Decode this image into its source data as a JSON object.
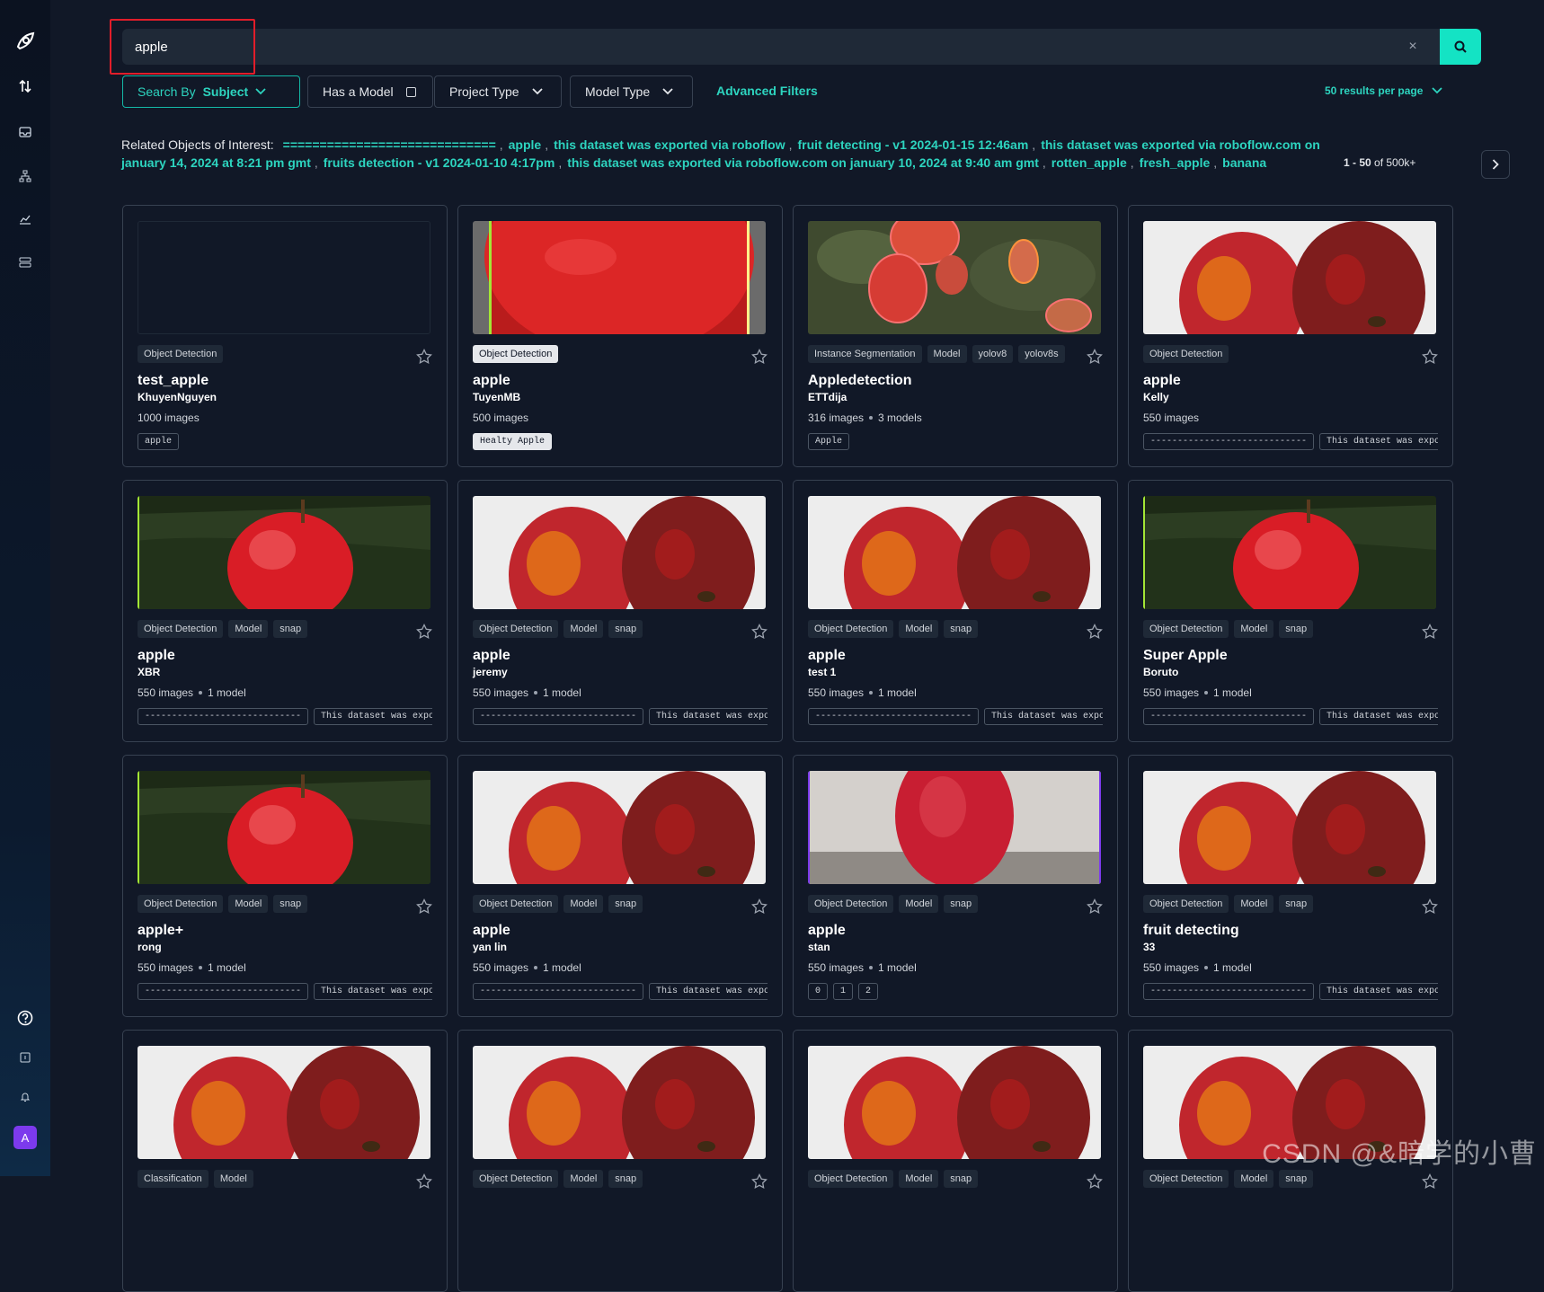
{
  "sidebar": {
    "avatar_letter": "A",
    "icons": [
      "roboflow-logo-icon",
      "sort-arrows-icon",
      "inbox-icon",
      "workflow-icon",
      "analytics-icon",
      "database-icon",
      "help-icon",
      "docs-icon",
      "bell-icon"
    ]
  },
  "search": {
    "value": "apple",
    "clear_label": "×"
  },
  "filters": {
    "search_by_prefix": "Search By",
    "search_by_value": "Subject",
    "has_model": "Has a Model",
    "project_type": "Project Type",
    "model_type": "Model Type",
    "advanced": "Advanced Filters",
    "per_page": "50 results per page"
  },
  "related": {
    "label": "Related Objects of Interest:",
    "objects": [
      "=============================",
      "apple",
      "this dataset was exported via roboflow",
      "fruit detecting - v1 2024-01-15 12:46am",
      "this dataset was exported via roboflow.com on january 14, 2024 at 8:21 pm gmt",
      "fruits detection - v1 2024-01-10 4:17pm",
      "this dataset was exported via roboflow.com on january 10, 2024 at 9:40 am gmt",
      "rotten_apple",
      "fresh_apple",
      "banana"
    ]
  },
  "pagination": {
    "range": "1 - 50",
    "of_total": "of 500k+"
  },
  "cards": [
    {
      "title": "test_apple",
      "owner": "KhuyenNguyen",
      "tags": [
        "Object Detection"
      ],
      "images": "1000 images",
      "models": "",
      "chips": [
        "apple"
      ],
      "thumb": "blank",
      "tag_style": "normal",
      "chip_style": "normal"
    },
    {
      "title": "apple",
      "owner": "TuyenMB",
      "tags": [
        "Object Detection"
      ],
      "images": "500 images",
      "models": "",
      "chips": [
        "Healty Apple"
      ],
      "thumb": "bigapple",
      "tag_style": "light",
      "chip_style": "light"
    },
    {
      "title": "Appledetection",
      "owner": "ETTdija",
      "tags": [
        "Instance Segmentation",
        "Model",
        "yolov8",
        "yolov8s"
      ],
      "images": "316 images",
      "models": "3 models",
      "chips": [
        "Apple"
      ],
      "thumb": "tree",
      "tag_style": "normal",
      "chip_style": "normal"
    },
    {
      "title": "apple",
      "owner": "Kelly",
      "tags": [
        "Object Detection"
      ],
      "images": "550 images",
      "models": "",
      "chips": [
        "-----------------------------",
        "This dataset was exported"
      ],
      "thumb": "twoapples",
      "tag_style": "normal",
      "chip_style": "normal"
    },
    {
      "title": "apple",
      "owner": "XBR",
      "tags": [
        "Object Detection",
        "Model",
        "snap"
      ],
      "images": "550 images",
      "models": "1 model",
      "chips": [
        "-----------------------------",
        "This dataset was exported"
      ],
      "thumb": "grass",
      "tag_style": "normal",
      "chip_style": "normal"
    },
    {
      "title": "apple",
      "owner": "jeremy",
      "tags": [
        "Object Detection",
        "Model",
        "snap"
      ],
      "images": "550 images",
      "models": "1 model",
      "chips": [
        "-----------------------------",
        "This dataset was exported"
      ],
      "thumb": "twoapples",
      "tag_style": "normal",
      "chip_style": "normal"
    },
    {
      "title": "apple",
      "owner": "test 1",
      "tags": [
        "Object Detection",
        "Model",
        "snap"
      ],
      "images": "550 images",
      "models": "1 model",
      "chips": [
        "-----------------------------",
        "This dataset was exported"
      ],
      "thumb": "twoapples",
      "tag_style": "normal",
      "chip_style": "normal"
    },
    {
      "title": "Super Apple",
      "owner": "Boruto",
      "tags": [
        "Object Detection",
        "Model",
        "snap"
      ],
      "images": "550 images",
      "models": "1 model",
      "chips": [
        "-----------------------------",
        "This dataset was exported"
      ],
      "thumb": "grass",
      "tag_style": "normal",
      "chip_style": "normal"
    },
    {
      "title": "apple+",
      "owner": "rong",
      "tags": [
        "Object Detection",
        "Model",
        "snap"
      ],
      "images": "550 images",
      "models": "1 model",
      "chips": [
        "-----------------------------",
        "This dataset was exported"
      ],
      "thumb": "grass",
      "tag_style": "normal",
      "chip_style": "normal"
    },
    {
      "title": "apple",
      "owner": "yan lin",
      "tags": [
        "Object Detection",
        "Model",
        "snap"
      ],
      "images": "550 images",
      "models": "1 model",
      "chips": [
        "-----------------------------",
        "This dataset was exported"
      ],
      "thumb": "twoapples",
      "tag_style": "normal",
      "chip_style": "normal"
    },
    {
      "title": "apple",
      "owner": "stan",
      "tags": [
        "Object Detection",
        "Model",
        "snap"
      ],
      "images": "550 images",
      "models": "1 model",
      "chips": [
        "0",
        "1",
        "2"
      ],
      "thumb": "wallapple",
      "tag_style": "normal",
      "chip_style": "normal"
    },
    {
      "title": "fruit detecting",
      "owner": "33",
      "tags": [
        "Object Detection",
        "Model",
        "snap"
      ],
      "images": "550 images",
      "models": "1 model",
      "chips": [
        "-----------------------------",
        "This dataset was exported"
      ],
      "thumb": "twoapples",
      "tag_style": "normal",
      "chip_style": "normal"
    },
    {
      "title": "",
      "owner": "",
      "tags": [
        "Classification",
        "Model"
      ],
      "images": "",
      "models": "",
      "chips": [],
      "thumb": "twoapples",
      "tag_style": "normal",
      "chip_style": "normal"
    },
    {
      "title": "",
      "owner": "",
      "tags": [
        "Object Detection",
        "Model",
        "snap"
      ],
      "images": "",
      "models": "",
      "chips": [],
      "thumb": "twoapples",
      "tag_style": "normal",
      "chip_style": "normal"
    },
    {
      "title": "",
      "owner": "",
      "tags": [
        "Object Detection",
        "Model",
        "snap"
      ],
      "images": "",
      "models": "",
      "chips": [],
      "thumb": "twoapples",
      "tag_style": "normal",
      "chip_style": "normal"
    },
    {
      "title": "",
      "owner": "",
      "tags": [
        "Object Detection",
        "Model",
        "snap"
      ],
      "images": "",
      "models": "",
      "chips": [],
      "thumb": "twoapples",
      "tag_style": "normal",
      "chip_style": "normal"
    }
  ],
  "watermark": "CSDN @&暗学的小曹",
  "colors": {
    "accent": "#14e3c4",
    "teal_text": "#2dd4bf",
    "background": "#111827",
    "highlight": "#e11d2a"
  }
}
